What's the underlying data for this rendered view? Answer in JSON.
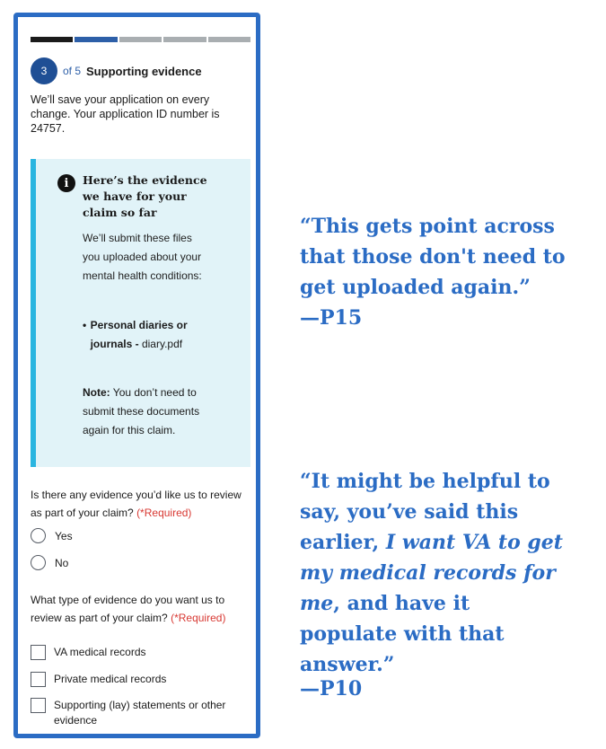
{
  "form": {
    "progress_segments": [
      {
        "state": "done"
      },
      {
        "state": "current"
      },
      {
        "state": "todo"
      },
      {
        "state": "todo"
      },
      {
        "state": "todo"
      }
    ],
    "step_number": "3",
    "step_of": "of 5",
    "step_title": "Supporting evidence",
    "save_text": "We’ll save your application on every change. Your application ID number is 24757.",
    "alert": {
      "icon": "info-icon",
      "heading": "Here’s the evidence we have for your claim so far",
      "body": "We’ll submit these files you uploaded about your mental health conditions:",
      "list_item_bold": "Personal diaries or journals -",
      "list_item_file": "diary.pdf",
      "note_label": "Note:",
      "note_text": "You don’t need to submit these documents again for this claim."
    },
    "question1": {
      "text": "Is there any evidence you’d like us to review as part of your claim?",
      "required": "(*Required)",
      "options": [
        "Yes",
        "No"
      ]
    },
    "question2": {
      "text": "What type of evidence do you want us to review as part of your claim?",
      "required": "(*Required)",
      "options": [
        "VA medical records",
        "Private medical records",
        "Supporting (lay) statements or other evidence"
      ]
    }
  },
  "quotes": {
    "q1_text": "“This  gets point across that those don't need to get uploaded again.”",
    "q1_attr": "—P15",
    "q2_part1": "“It might be helpful to say, you’ve said this earlier, ",
    "q2_italic": "I want VA to get my medical records for me",
    "q2_part2": ", and have it populate with that answer.”",
    "q2_attr": "—P10"
  },
  "colors": {
    "accent_blue": "#2b6cc4",
    "step_circle": "#1f4f95",
    "alert_bg": "#e1f3f8",
    "alert_border": "#2ab5e0",
    "required_red": "#d83933"
  }
}
